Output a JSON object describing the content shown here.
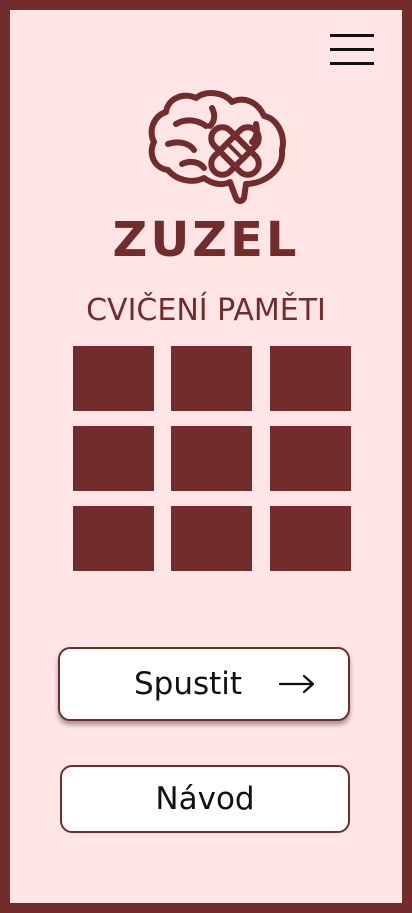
{
  "app": {
    "title": "ZUZEL",
    "subtitle": "CVIČENÍ PAMĚTI"
  },
  "colors": {
    "brand": "#722c2c",
    "background": "#ffe5e5",
    "button_bg": "#ffffff",
    "text": "#111111"
  },
  "icons": {
    "menu": "hamburger-menu-icon",
    "logo": "brain-bandage-icon",
    "arrow": "arrow-right-icon"
  },
  "grid": {
    "rows": 3,
    "columns": 3
  },
  "buttons": {
    "start_label": "Spustit",
    "guide_label": "Návod"
  }
}
